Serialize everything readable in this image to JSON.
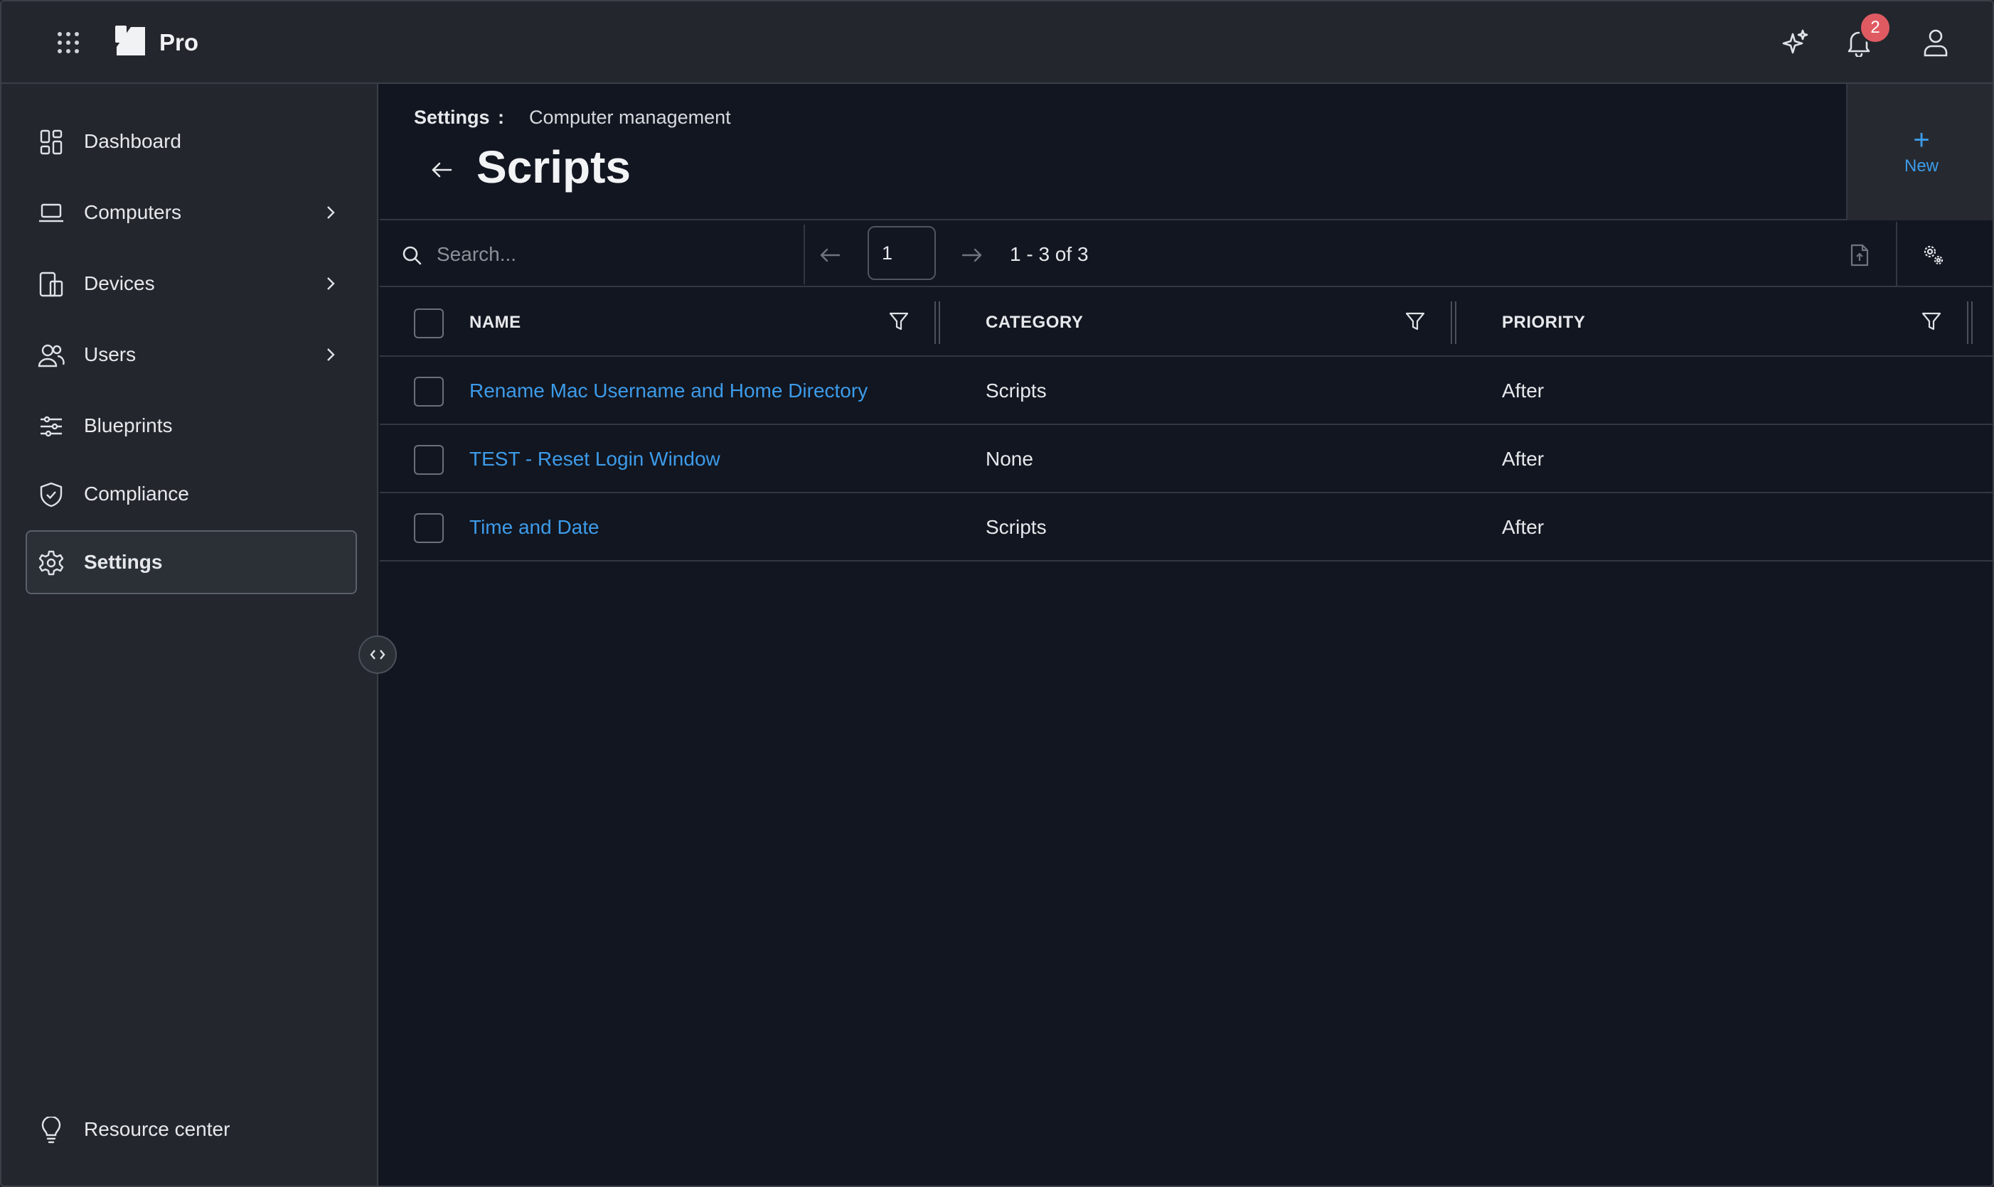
{
  "app": {
    "brand": "Pro",
    "notification_count": "2"
  },
  "sidebar": {
    "items": [
      {
        "label": "Dashboard",
        "icon": "dashboard-icon",
        "has_chevron": false
      },
      {
        "label": "Computers",
        "icon": "laptop-icon",
        "has_chevron": true
      },
      {
        "label": "Devices",
        "icon": "devices-icon",
        "has_chevron": true
      },
      {
        "label": "Users",
        "icon": "users-icon",
        "has_chevron": true
      },
      {
        "label": "Blueprints",
        "icon": "sliders-icon",
        "has_chevron": false
      },
      {
        "label": "Compliance",
        "icon": "shield-check-icon",
        "has_chevron": false
      },
      {
        "label": "Settings",
        "icon": "gear-icon",
        "has_chevron": false,
        "active": true
      }
    ],
    "footer": {
      "label": "Resource center",
      "icon": "lightbulb-icon"
    }
  },
  "header": {
    "breadcrumb_root": "Settings",
    "breadcrumb_sep": ":",
    "breadcrumb_current": "Computer management",
    "title": "Scripts",
    "new_label": "New",
    "new_glyph": "+"
  },
  "toolbar": {
    "search_placeholder": "Search...",
    "page": "1",
    "range": "1 - 3 of 3"
  },
  "table": {
    "columns": [
      "NAME",
      "CATEGORY",
      "PRIORITY"
    ],
    "rows": [
      {
        "name": "Rename Mac Username and Home Directory",
        "category": "Scripts",
        "priority": "After"
      },
      {
        "name": "TEST - Reset Login Window",
        "category": "None",
        "priority": "After"
      },
      {
        "name": "Time and Date",
        "category": "Scripts",
        "priority": "After"
      }
    ]
  },
  "colors": {
    "accent": "#3d9be9",
    "badge": "#e05a62",
    "background": "#121620",
    "sidebar": "#23272d"
  }
}
